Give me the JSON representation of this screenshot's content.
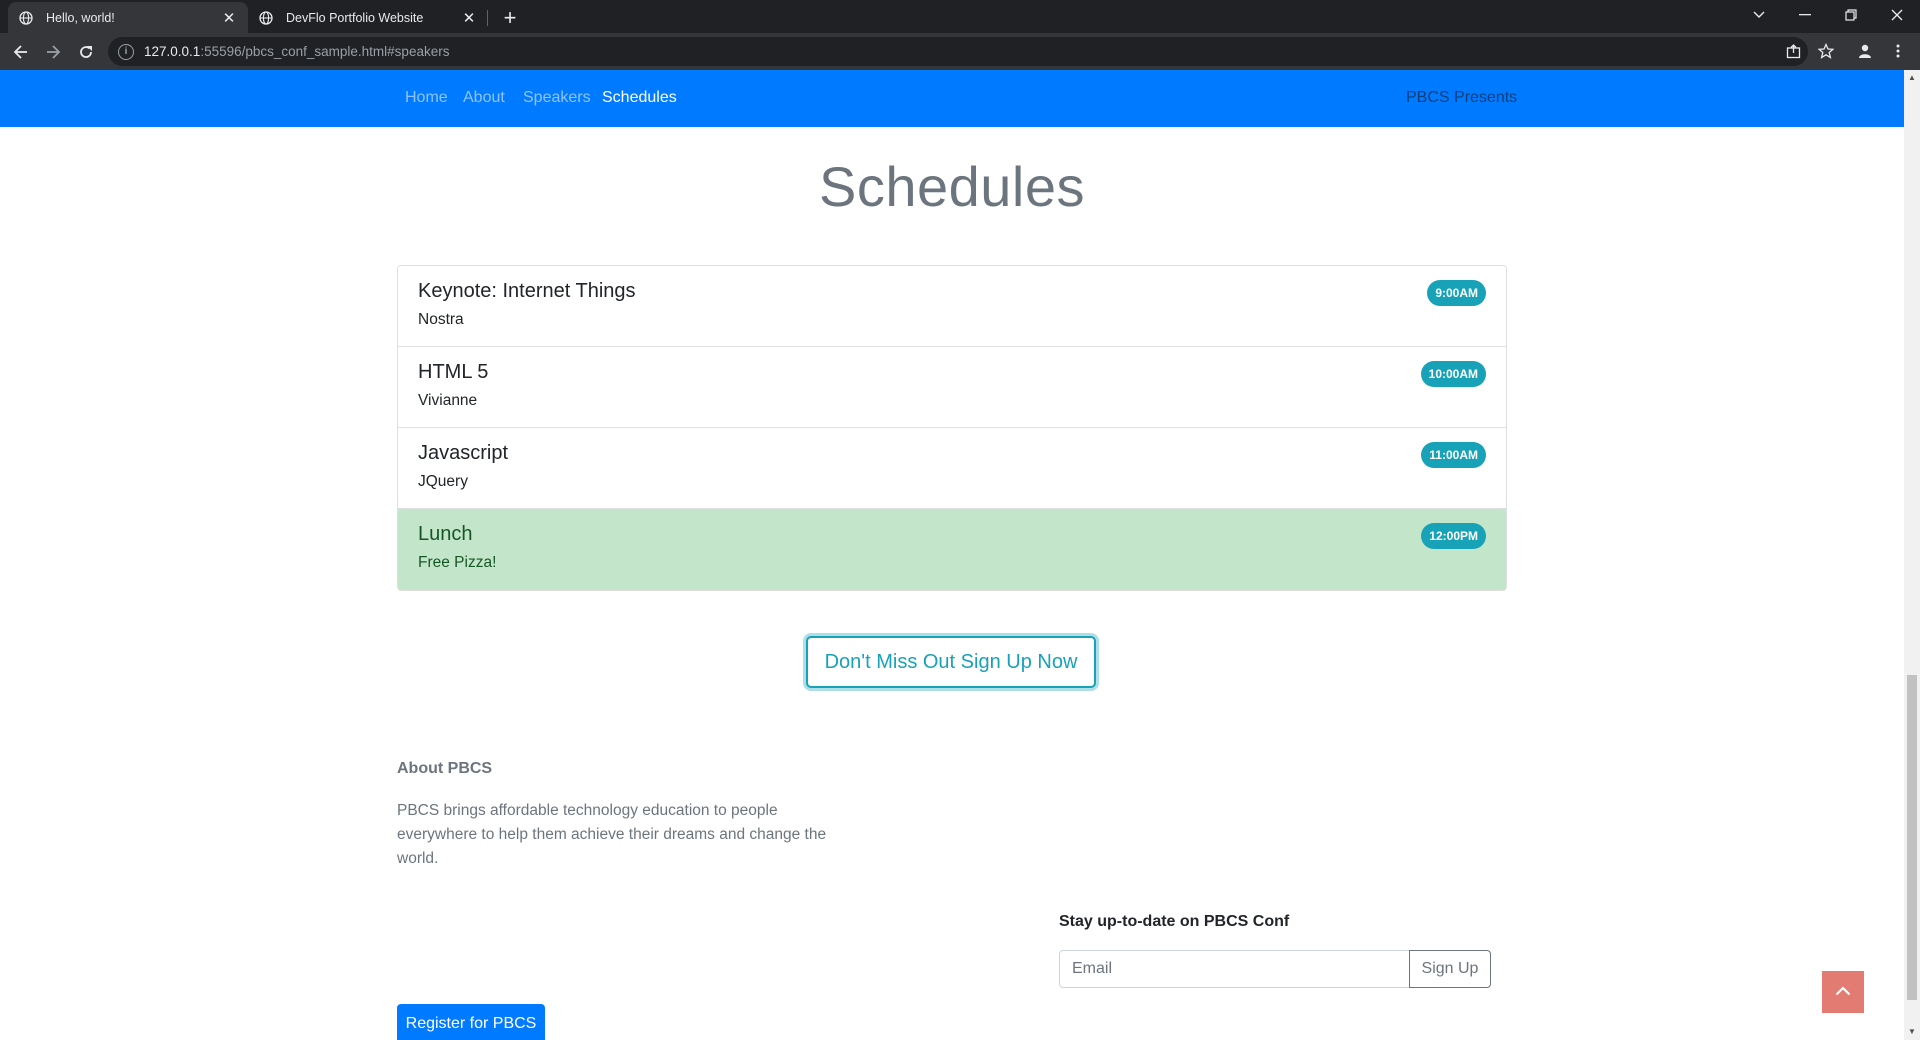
{
  "browser": {
    "tabs": [
      {
        "title": "Hello, world!",
        "active": true
      },
      {
        "title": "DevFlo Portfolio Website",
        "active": false
      }
    ],
    "url_host": "127.0.0.1",
    "url_rest": ":55596/pbcs_conf_sample.html#speakers"
  },
  "nav": {
    "links": [
      "Home",
      "About",
      "Speakers",
      "Schedules"
    ],
    "active": "Schedules",
    "brand": "PBCS Presents"
  },
  "schedules": {
    "title": "Schedules",
    "items": [
      {
        "title": "Keynote: Internet Things",
        "speaker": "Nostra",
        "time": "9:00AM"
      },
      {
        "title": "HTML 5",
        "speaker": "Vivianne",
        "time": "10:00AM"
      },
      {
        "title": "Javascript",
        "speaker": "JQuery",
        "time": "11:00AM"
      },
      {
        "title": "Lunch",
        "speaker": "Free Pizza!",
        "time": "12:00PM"
      }
    ],
    "cta": "Don't Miss Out Sign Up Now"
  },
  "footer": {
    "about_title": "About PBCS",
    "about_text": "PBCS brings affordable technology education to people everywhere to help them achieve their dreams and change the world.",
    "stay_title": "Stay up-to-date on PBCS Conf",
    "email_placeholder": "Email",
    "signup_label": "Sign Up",
    "register_label": "Register for PBCS"
  },
  "colors": {
    "primary": "#007bff",
    "info": "#17a2b8",
    "success_bg": "#c3e6cb",
    "totop": "#e27b72"
  }
}
